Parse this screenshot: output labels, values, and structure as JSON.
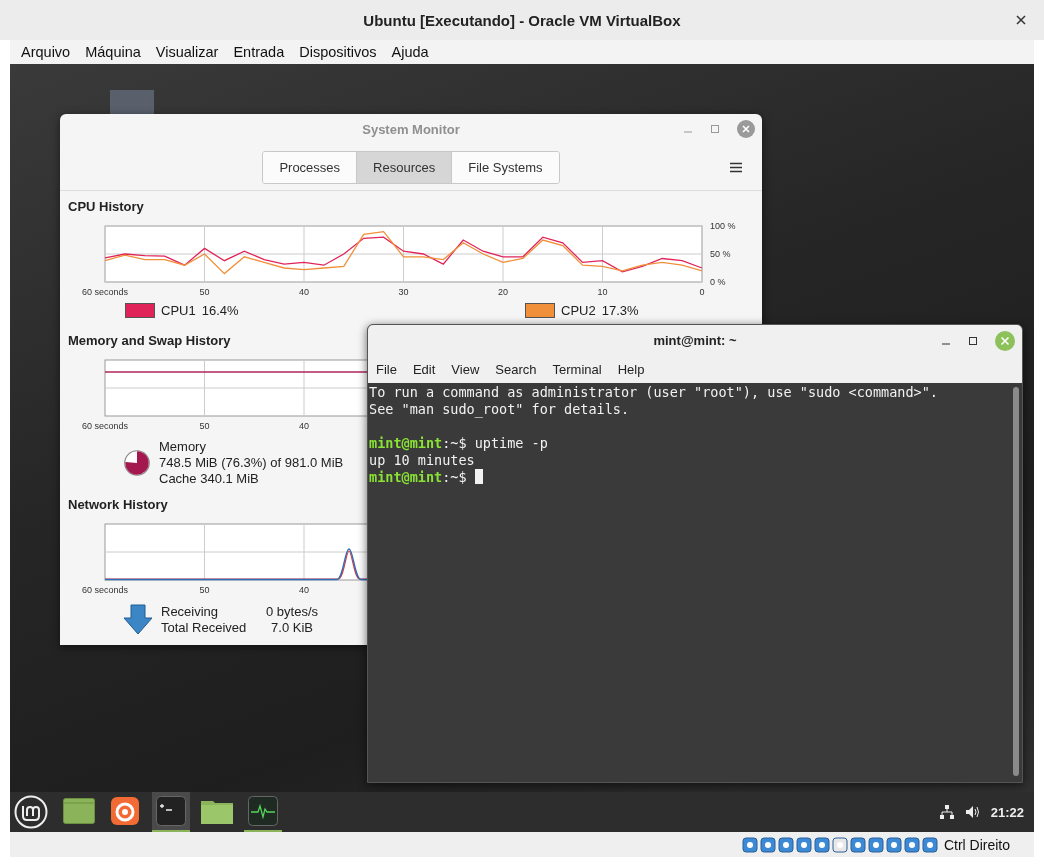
{
  "window": {
    "title": "Ubuntu [Executando] - Oracle VM VirtualBox"
  },
  "menu": [
    "Arquivo",
    "Máquina",
    "Visualizar",
    "Entrada",
    "Dispositivos",
    "Ajuda"
  ],
  "system_monitor": {
    "title": "System Monitor",
    "tabs": [
      {
        "label": "Processes",
        "selected": false
      },
      {
        "label": "Resources",
        "selected": true
      },
      {
        "label": "File Systems",
        "selected": false
      }
    ],
    "cpu": {
      "heading": "CPU History",
      "chart_data": {
        "type": "line",
        "grid": true,
        "x": [
          60,
          58,
          56,
          54,
          52,
          50,
          48,
          46,
          44,
          42,
          40,
          38,
          36,
          34,
          32,
          30,
          28,
          26,
          24,
          22,
          20,
          18,
          16,
          14,
          12,
          10,
          8,
          6,
          4,
          2,
          0
        ],
        "xlim": [
          60,
          0
        ],
        "ylim": [
          0,
          100
        ],
        "xticks": [
          {
            "value": 60,
            "label": "60 seconds"
          },
          {
            "value": 50,
            "label": "50"
          },
          {
            "value": 40,
            "label": "40"
          },
          {
            "value": 30,
            "label": "30"
          },
          {
            "value": 20,
            "label": "20"
          },
          {
            "value": 10,
            "label": "10"
          },
          {
            "value": 0,
            "label": "0"
          }
        ],
        "yticks": [
          {
            "value": 0,
            "label": "0 %"
          },
          {
            "value": 50,
            "label": "50 %"
          },
          {
            "value": 100,
            "label": "100 %"
          }
        ],
        "series": [
          {
            "name": "CPU1",
            "color": "#e0245a",
            "values": [
              43,
              50,
              47,
              46,
              30,
              60,
              38,
              55,
              40,
              32,
              35,
              30,
              50,
              78,
              80,
              55,
              50,
              32,
              75,
              55,
              45,
              45,
              80,
              70,
              35,
              38,
              18,
              28,
              42,
              38,
              25
            ]
          },
          {
            "name": "CPU2",
            "color": "#f0903a",
            "values": [
              38,
              48,
              40,
              40,
              30,
              50,
              15,
              45,
              35,
              25,
              22,
              25,
              28,
              85,
              90,
              45,
              45,
              40,
              70,
              50,
              35,
              42,
              75,
              65,
              30,
              28,
              20,
              30,
              35,
              30,
              20
            ]
          }
        ]
      },
      "readings": [
        "16.4%",
        "17.3%"
      ]
    },
    "memory": {
      "heading": "Memory and Swap History",
      "x_ticks": [
        "60 seconds",
        "50",
        "40"
      ],
      "label": "Memory",
      "usage": "748.5 MiB (76.3%) of 981.0 MiB",
      "cache": "Cache 340.1 MiB",
      "level": 0.763
    },
    "network": {
      "heading": "Network History",
      "x_ticks": [
        "60 seconds",
        "50",
        "40"
      ],
      "rows": [
        {
          "label": "Receiving",
          "value": "0 bytes/s"
        },
        {
          "label": "Total Received",
          "value": "7.0 KiB"
        }
      ]
    }
  },
  "terminal": {
    "title": "mint@mint: ~",
    "menu": [
      "File",
      "Edit",
      "View",
      "Search",
      "Terminal",
      "Help"
    ],
    "lines": [
      {
        "kind": "output",
        "text": "To run a command as administrator (user \"root\"), use \"sudo <command>\"."
      },
      {
        "kind": "output",
        "text": "See \"man sudo_root\" for details."
      },
      {
        "kind": "blank"
      },
      {
        "kind": "prompt",
        "user": "mint@mint",
        "path": ":~$",
        "command": "uptime -p"
      },
      {
        "kind": "output",
        "text": "up 10 minutes"
      },
      {
        "kind": "prompt",
        "user": "mint@mint",
        "path": ":~$",
        "cursor": true
      }
    ]
  },
  "taskbar": {
    "apps": [
      {
        "kind": "desktop",
        "running": false,
        "focused": false
      },
      {
        "kind": "browser",
        "running": false,
        "focused": false
      },
      {
        "kind": "terminal",
        "running": true,
        "focused": true
      },
      {
        "kind": "files",
        "running": false,
        "focused": false
      },
      {
        "kind": "monitor",
        "running": true,
        "focused": false
      }
    ],
    "clock": "21:22"
  },
  "status_bar": {
    "host_key": "Ctrl Direito"
  }
}
